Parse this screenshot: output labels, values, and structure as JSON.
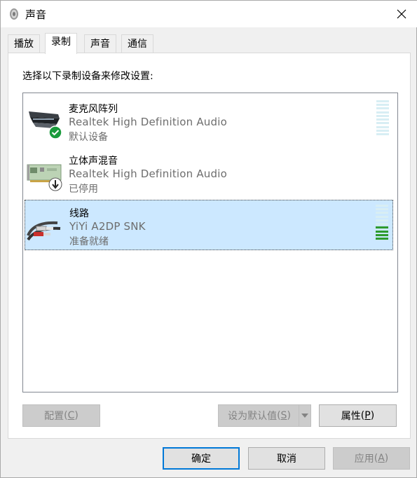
{
  "window": {
    "title": "声音"
  },
  "tabs": [
    {
      "label": "播放",
      "active": false
    },
    {
      "label": "录制",
      "active": true
    },
    {
      "label": "声音",
      "active": false
    },
    {
      "label": "通信",
      "active": false
    }
  ],
  "panel": {
    "instruction": "选择以下录制设备来修改设置:",
    "devices": [
      {
        "name": "麦克风阵列",
        "description": "Realtek High Definition Audio",
        "status": "默认设备",
        "icon": "microphone-array-icon",
        "badge": "default-check-icon",
        "selected": false,
        "level": 0
      },
      {
        "name": "立体声混音",
        "description": "Realtek High Definition Audio",
        "status": "已停用",
        "icon": "sound-card-icon",
        "badge": "disabled-arrow-icon",
        "selected": false,
        "level": null
      },
      {
        "name": "线路",
        "description": "YiYi A2DP SNK",
        "status": "准备就绪",
        "icon": "line-in-cable-icon",
        "badge": null,
        "selected": true,
        "level": 0.3
      }
    ]
  },
  "buttons": {
    "configure": {
      "label": "配置",
      "accel": "C"
    },
    "set_default": {
      "label": "设为默认值",
      "accel": "S"
    },
    "properties": {
      "label": "属性",
      "accel": "P"
    },
    "ok": "确定",
    "cancel": "取消",
    "apply": {
      "label": "应用",
      "accel": "A"
    }
  },
  "colors": {
    "selection": "#cce8ff",
    "default_button_border": "#0078d7",
    "meter_idle": "#d8eef4",
    "meter_active": "#2e9b2e",
    "check_badge": "#1a9b3c"
  }
}
